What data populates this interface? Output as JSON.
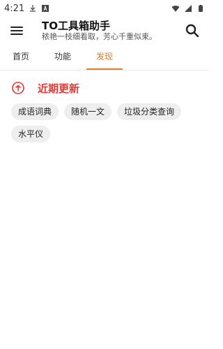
{
  "status_bar": {
    "time": "4:21",
    "icons": [
      "download-icon",
      "a-icon",
      "wifi-icon",
      "signal-icon",
      "battery-icon"
    ]
  },
  "app_bar": {
    "title": "TO工具箱助手",
    "subtitle": "秾艳一枝细看取，芳心千重似束。",
    "menu_icon": "menu-icon",
    "search_icon": "search-icon"
  },
  "tabs": [
    {
      "label": "首页",
      "active": false
    },
    {
      "label": "功能",
      "active": false
    },
    {
      "label": "发现",
      "active": true
    }
  ],
  "recent": {
    "title": "近期更新",
    "icon": "upload-circle-icon",
    "items": [
      "成语词典",
      "随机一文",
      "垃圾分类查询",
      "水平仪"
    ]
  },
  "colors": {
    "accent": "#e07a2f",
    "recent_title": "#e53935",
    "chip_bg": "#eeeeee"
  }
}
